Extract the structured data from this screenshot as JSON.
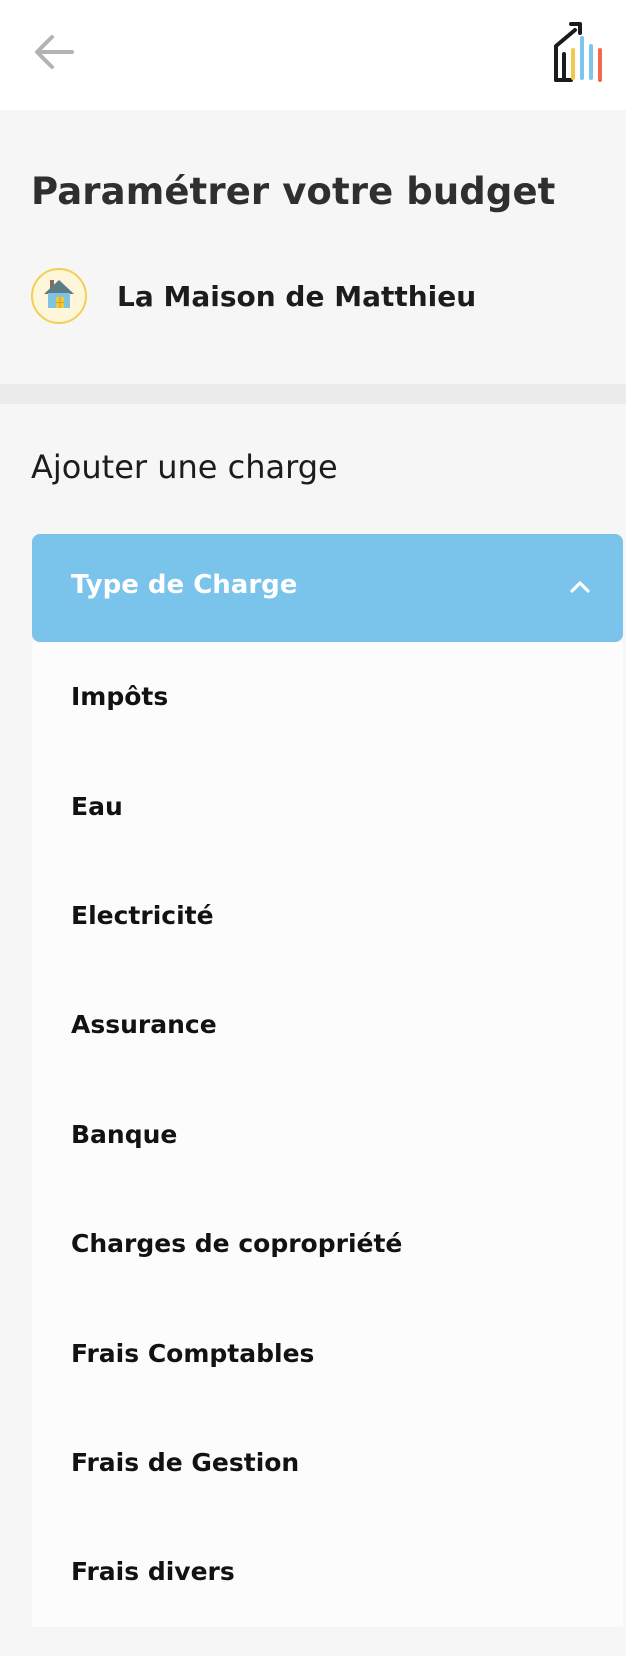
{
  "header": {
    "back_icon": "arrow-left-icon",
    "logo_icon": "house-bar-chart-logo"
  },
  "page": {
    "title": "Paramétrer votre budget"
  },
  "property": {
    "name": "La Maison de Matthieu",
    "icon": "house-icon",
    "icon_border_color": "#f2cf55"
  },
  "section": {
    "title": "Ajouter une charge"
  },
  "dropdown": {
    "label": "Type de Charge",
    "state": "open",
    "chevron_icon": "chevron-up-icon",
    "color": "#7ac3eb",
    "options": [
      {
        "label": "Impôts"
      },
      {
        "label": "Eau"
      },
      {
        "label": "Electricité"
      },
      {
        "label": "Assurance"
      },
      {
        "label": "Banque"
      },
      {
        "label": "Charges de copropriété"
      },
      {
        "label": "Frais Comptables"
      },
      {
        "label": "Frais de Gestion"
      },
      {
        "label": "Frais divers"
      }
    ]
  }
}
